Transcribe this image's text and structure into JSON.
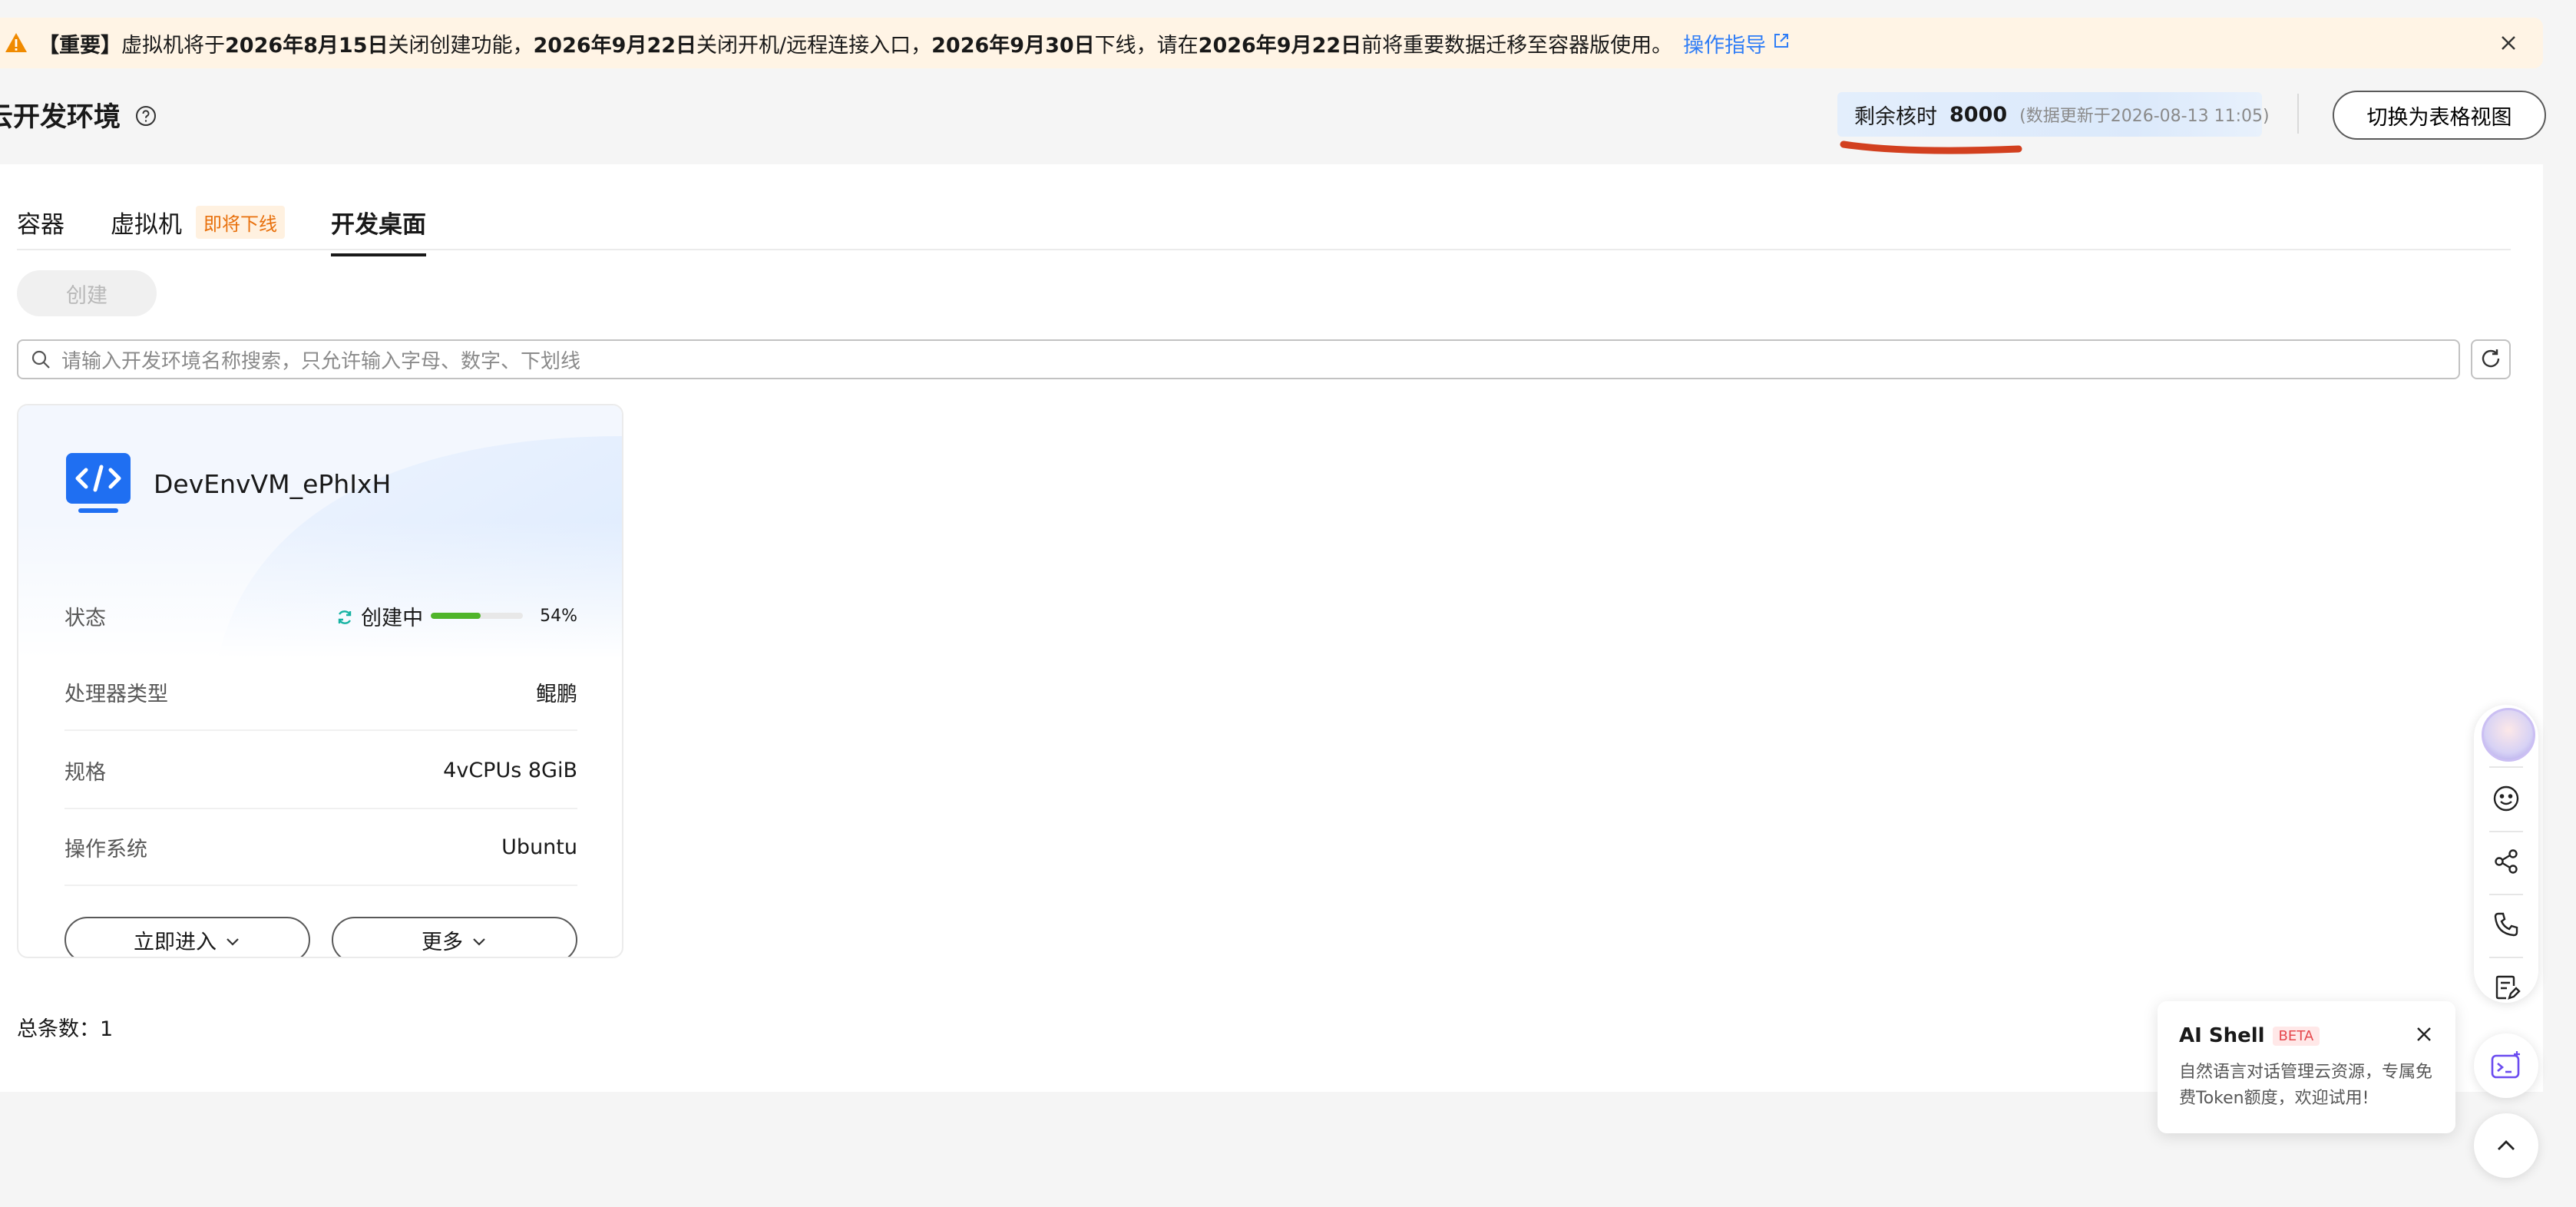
{
  "notice": {
    "segments": [
      {
        "text": "【重要】",
        "bold": true
      },
      {
        "text": "虚拟机将于",
        "bold": false
      },
      {
        "text": "2026年8月15日",
        "bold": true
      },
      {
        "text": "关闭创建功能，",
        "bold": false
      },
      {
        "text": "2026年9月22日",
        "bold": true
      },
      {
        "text": "关闭开机/远程连接入口，",
        "bold": false
      },
      {
        "text": "2026年9月30日",
        "bold": true
      },
      {
        "text": "下线，请在",
        "bold": false
      },
      {
        "text": "2026年9月22日",
        "bold": true
      },
      {
        "text": "前将重要数据迁移至容器版使用。",
        "bold": false
      }
    ],
    "link_label": "操作指导",
    "color_bg": "#fff4e5",
    "icons": {
      "warning": "warning-icon",
      "close": "close-icon",
      "external": "external-link-icon"
    }
  },
  "header": {
    "title": "云开发环境",
    "quota_label": "剩余核时",
    "quota_value": "8000",
    "quota_update": "(数据更新于2026-08-13 11:05)",
    "table_view_label": "切换为表格视图"
  },
  "tabs": [
    {
      "label": "容器",
      "badge": ""
    },
    {
      "label": "虚拟机",
      "badge": "即将下线"
    },
    {
      "label": "开发桌面",
      "badge": ""
    }
  ],
  "active_tab": "开发桌面",
  "toolbar": {
    "create_label": "创建",
    "search_placeholder": "请输入开发环境名称搜索，只允许输入字母、数字、下划线"
  },
  "card": {
    "name": "DevEnvVM_ePhIxH",
    "rows": [
      {
        "key": "状态",
        "value": "创建中"
      },
      {
        "key": "处理器类型",
        "value": "鲲鹏"
      },
      {
        "key": "规格",
        "value": "4vCPUs 8GiB"
      },
      {
        "key": "操作系统",
        "value": "Ubuntu"
      }
    ],
    "progress": 54,
    "progress_label": "54%",
    "enter_label": "立即进入",
    "more_label": "更多"
  },
  "footer": {
    "total": "总条数：1"
  },
  "ai_shell": {
    "title": "AI Shell",
    "badge": "BETA",
    "desc": "自然语言对话管理云资源，专属免费Token额度，欢迎试用!"
  },
  "colors": {
    "accent": "#2f7df6",
    "progress": "#4fb52a",
    "badge_orange": "#e8700c",
    "underline": "#d2401f"
  }
}
